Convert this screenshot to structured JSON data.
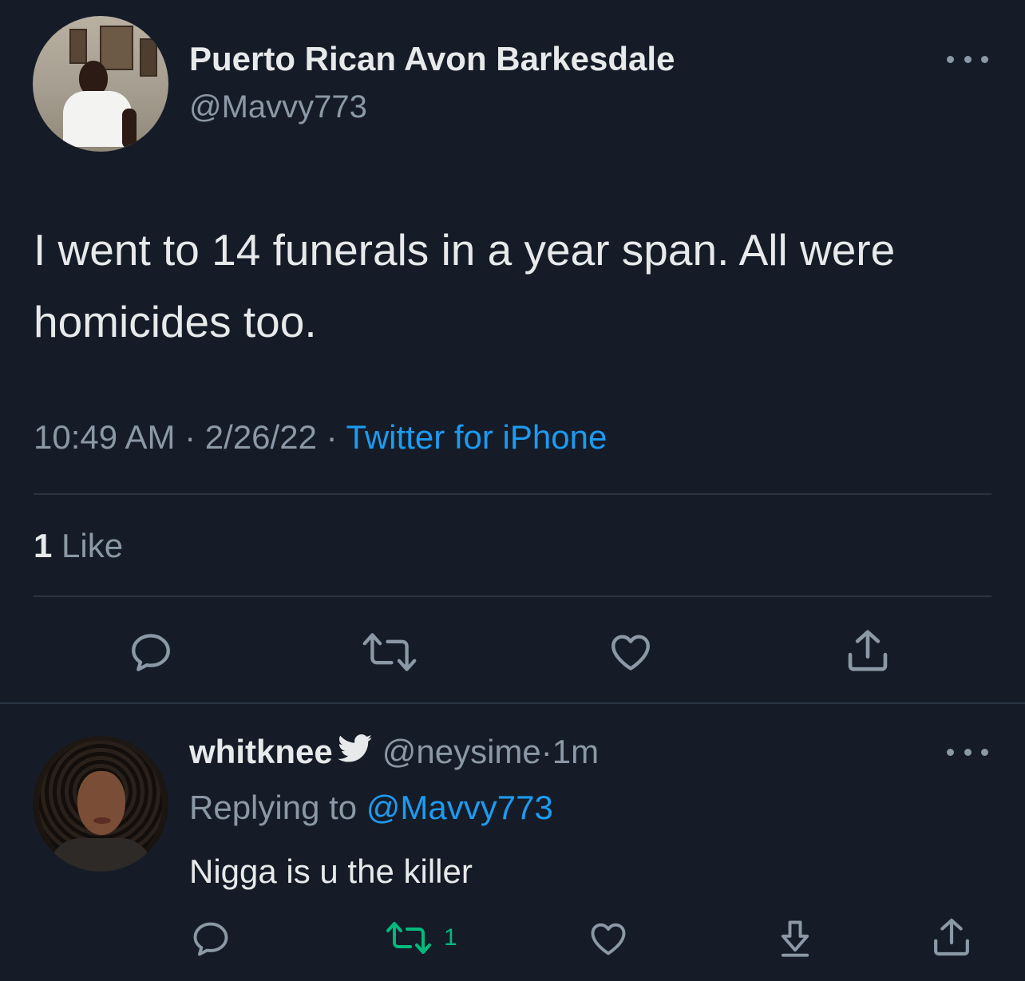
{
  "tweet": {
    "author_name": "Puerto Rican Avon Barkesdale",
    "author_handle": "@Mavvy773",
    "text": "I went to 14 funerals in a year span. All were homicides too.",
    "time": "10:49 AM",
    "date": "2/26/22",
    "separator": " · ",
    "source": "Twitter for iPhone",
    "like_count": "1",
    "like_label": "Like"
  },
  "reply": {
    "author_name": "whitknee",
    "author_handle": "@neysime",
    "separator": " · ",
    "time": "1m",
    "replying_prefix": "Replying to ",
    "replying_mention": "@Mavvy773",
    "text": "Nigga is u the killer",
    "retweet_count": "1"
  },
  "colors": {
    "background": "#151c28",
    "text_primary": "#e7e9ea",
    "text_secondary": "#8b98a5",
    "link": "#1d9bf0",
    "retweet_active": "#00ba7c",
    "divider": "#2a3340"
  },
  "icons": {
    "more": "more-horizontal-icon",
    "reply": "reply-icon",
    "retweet": "retweet-icon",
    "like": "heart-icon",
    "share": "share-icon",
    "download": "download-icon",
    "bird": "twitter-bird-icon"
  }
}
